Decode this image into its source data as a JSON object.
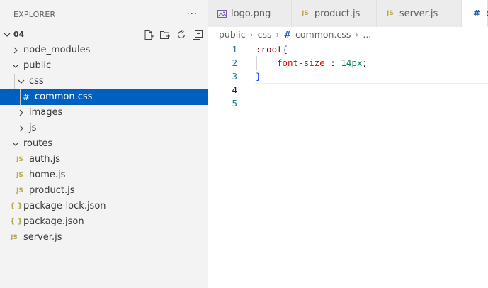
{
  "explorer": {
    "title": "EXPLORER",
    "more": "···",
    "root": "04",
    "items": [
      {
        "label": "node_modules",
        "type": "folder",
        "expanded": false
      },
      {
        "label": "public",
        "type": "folder",
        "expanded": true
      },
      {
        "label": "css",
        "type": "folder",
        "expanded": true
      },
      {
        "label": "common.css",
        "type": "css",
        "selected": true
      },
      {
        "label": "images",
        "type": "folder",
        "expanded": false
      },
      {
        "label": "js",
        "type": "folder",
        "expanded": false
      },
      {
        "label": "routes",
        "type": "folder",
        "expanded": true
      },
      {
        "label": "auth.js",
        "type": "js"
      },
      {
        "label": "home.js",
        "type": "js"
      },
      {
        "label": "product.js",
        "type": "js"
      },
      {
        "label": "package-lock.json",
        "type": "json"
      },
      {
        "label": "package.json",
        "type": "json"
      },
      {
        "label": "server.js",
        "type": "js"
      }
    ],
    "icons": {
      "js": "JS",
      "json": "{ }",
      "css": "#"
    }
  },
  "tabs": [
    {
      "label": "logo.png",
      "icon": "image-icon"
    },
    {
      "label": "product.js",
      "icon": "JS"
    },
    {
      "label": "server.js",
      "icon": "JS"
    },
    {
      "label": "c",
      "icon": "#"
    }
  ],
  "breadcrumb": {
    "items": [
      "public",
      "css",
      "common.css"
    ],
    "sep": "›",
    "hash": "#",
    "tail": "..."
  },
  "editor": {
    "line_numbers": [
      "1",
      "2",
      "3",
      "4",
      "5"
    ],
    "current_line": 4,
    "code": {
      "l1_sel": ":root",
      "l1_brace": "{",
      "l2_prop": "font-size",
      "l2_colon": " : ",
      "l2_value": "14px",
      "l2_semi": ";",
      "l3_brace": "}"
    }
  },
  "colors": {
    "selection": "#0060c0",
    "sidebar_bg": "#f3f3f3",
    "line_number": "#237893",
    "js_icon": "#b8a94c"
  }
}
